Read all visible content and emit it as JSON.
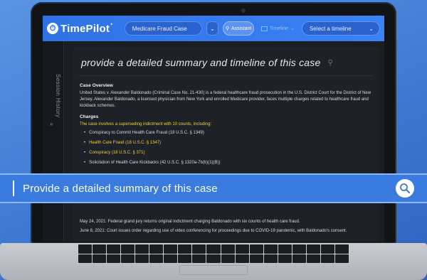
{
  "app": {
    "logo_text": "TimePilot",
    "logo_sup": "+",
    "case_select_value": "Medicare Fraud Case",
    "assistant_label": "Assistant",
    "timeline_label": "Timeline",
    "timeline_select_placeholder": "Select a timeline"
  },
  "sidebar": {
    "label": "Session History"
  },
  "content": {
    "prompt": "provide a detailed summary and timeline of this case",
    "case_overview_heading": "Case Overview",
    "case_overview_text": "United States v. Alexander Baldonado (Criminal Case No. 21-430) is a federal healthcare fraud prosecution in the U.S. District Court for the District of New Jersey. Alexander Baldonado, a licensed physician from New York and enrolled Medicare provider, faces multiple charges related to healthcare fraud and kickback schemes.",
    "charges_heading": "Charges",
    "charges_intro": "The case involves a superseding indictment with 10 counts, including:",
    "charges": [
      {
        "text": "Conspiracy to Commit Health Care Fraud (18 U.S.C. § 1349)",
        "highlight": false
      },
      {
        "text": "Health Care Fraud (18 U.S.C. § 1347)",
        "highlight": true
      },
      {
        "text": "Conspiracy (18 U.S.C. § 371)",
        "highlight": true
      },
      {
        "text": "Solicitation of Health Care Kickbacks (42 U.S.C. § 1320a-7b(b)(1)(B))",
        "highlight": false
      }
    ],
    "timeline_items": [
      "May 24, 2021: Federal grand jury returns original indictment charging Baldonado with six counts of health care fraud.",
      "June 8, 2021: Court issues order regarding use of video conferencing for proceedings due to COVID-19 pandemic, with Baldonado's consent."
    ]
  },
  "search": {
    "text": "Provide a detailed summary of this case"
  },
  "colors": {
    "accent": "#3b82f6",
    "highlight": "#f2d21a",
    "background": "#4a86df"
  }
}
